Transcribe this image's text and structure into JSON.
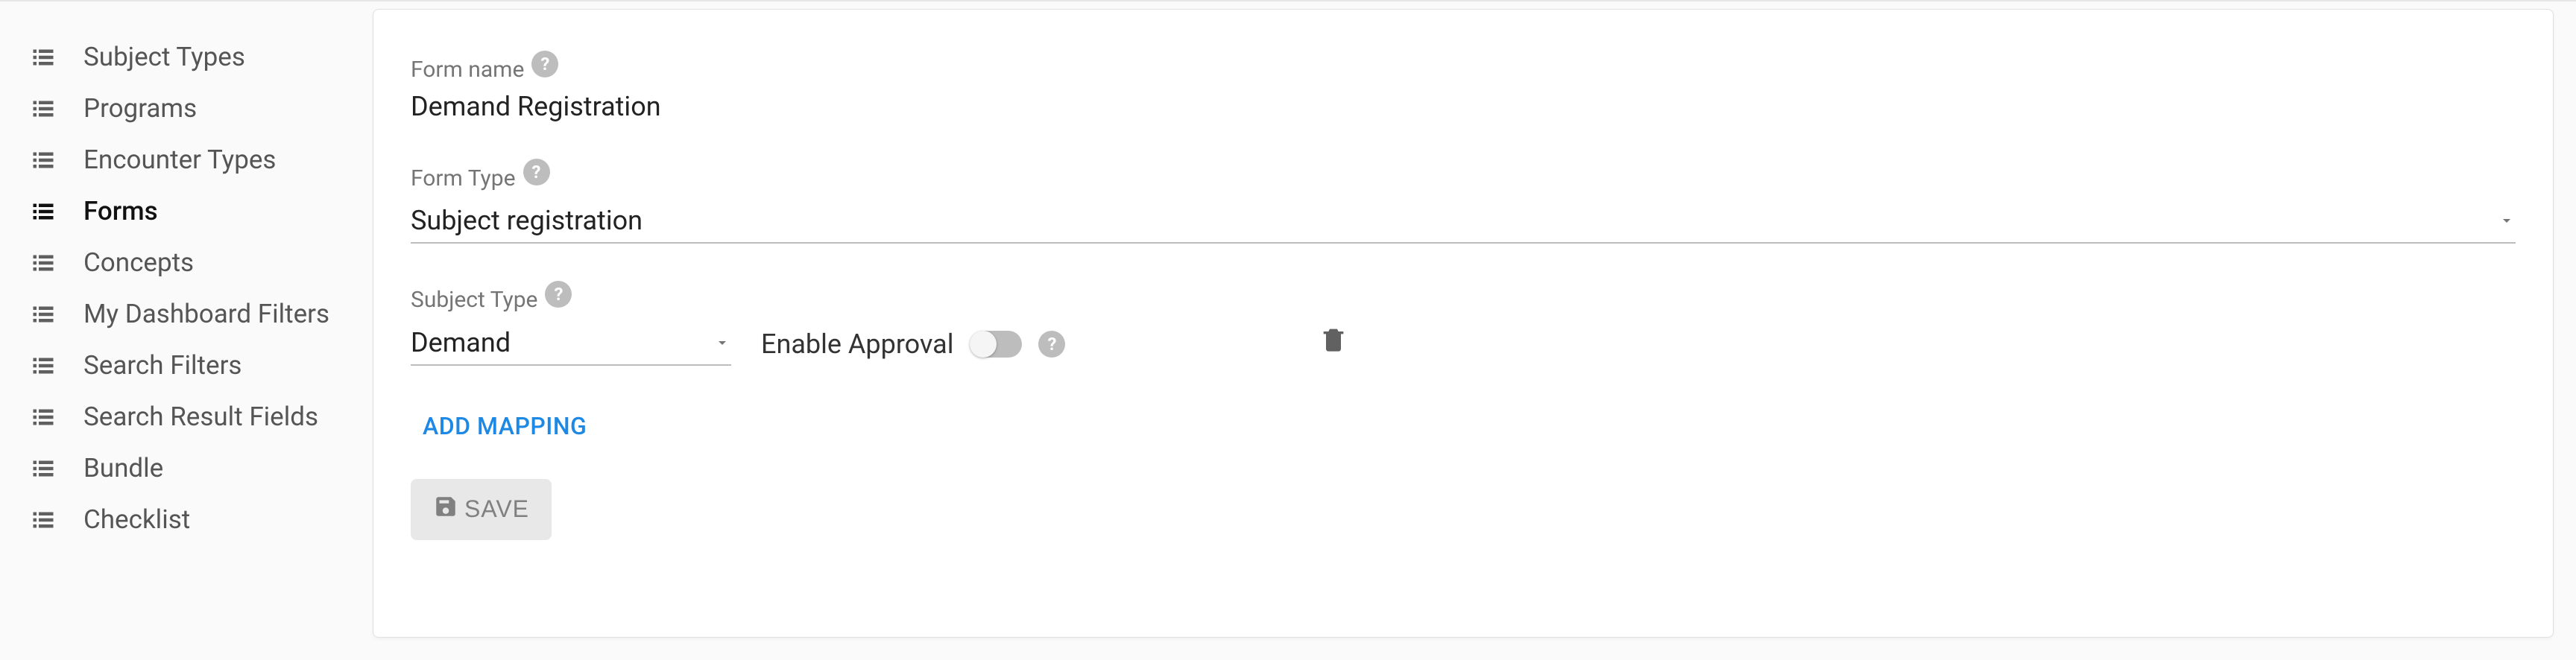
{
  "sidebar": {
    "items": [
      {
        "label": "Subject Types"
      },
      {
        "label": "Programs"
      },
      {
        "label": "Encounter Types"
      },
      {
        "label": "Forms"
      },
      {
        "label": "Concepts"
      },
      {
        "label": "My Dashboard Filters"
      },
      {
        "label": "Search Filters"
      },
      {
        "label": "Search Result Fields"
      },
      {
        "label": "Bundle"
      },
      {
        "label": "Checklist"
      }
    ],
    "activeIndex": 3
  },
  "main": {
    "formNameLabel": "Form name",
    "formNameValue": "Demand Registration",
    "formTypeLabel": "Form Type",
    "formTypeValue": "Subject registration",
    "subjectTypeLabel": "Subject Type",
    "subjectTypeValue": "Demand",
    "enableApprovalLabel": "Enable Approval",
    "enableApprovalValue": false,
    "addMappingLabel": "ADD MAPPING",
    "saveLabel": "SAVE"
  }
}
